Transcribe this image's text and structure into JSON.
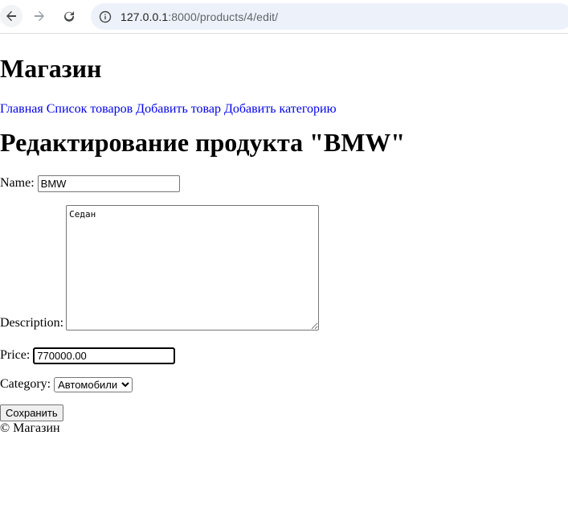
{
  "browser": {
    "url_host": "127.0.0.1",
    "url_path": ":8000/products/4/edit/"
  },
  "site": {
    "title": "Магазин"
  },
  "nav": {
    "items": [
      {
        "label": "Главная"
      },
      {
        "label": "Список товаров"
      },
      {
        "label": "Добавить товар"
      },
      {
        "label": "Добавить категорию"
      }
    ]
  },
  "page": {
    "title": "Редактирование продукта \"BMW\""
  },
  "form": {
    "name_label": "Name:",
    "name_value": "BMW",
    "description_label": "Description:",
    "description_value": "Седан",
    "price_label": "Price:",
    "price_value": "770000.00",
    "category_label": "Category:",
    "category_selected": "Автомобили",
    "submit_label": "Сохранить"
  },
  "footer": {
    "text": "© Магазин"
  }
}
